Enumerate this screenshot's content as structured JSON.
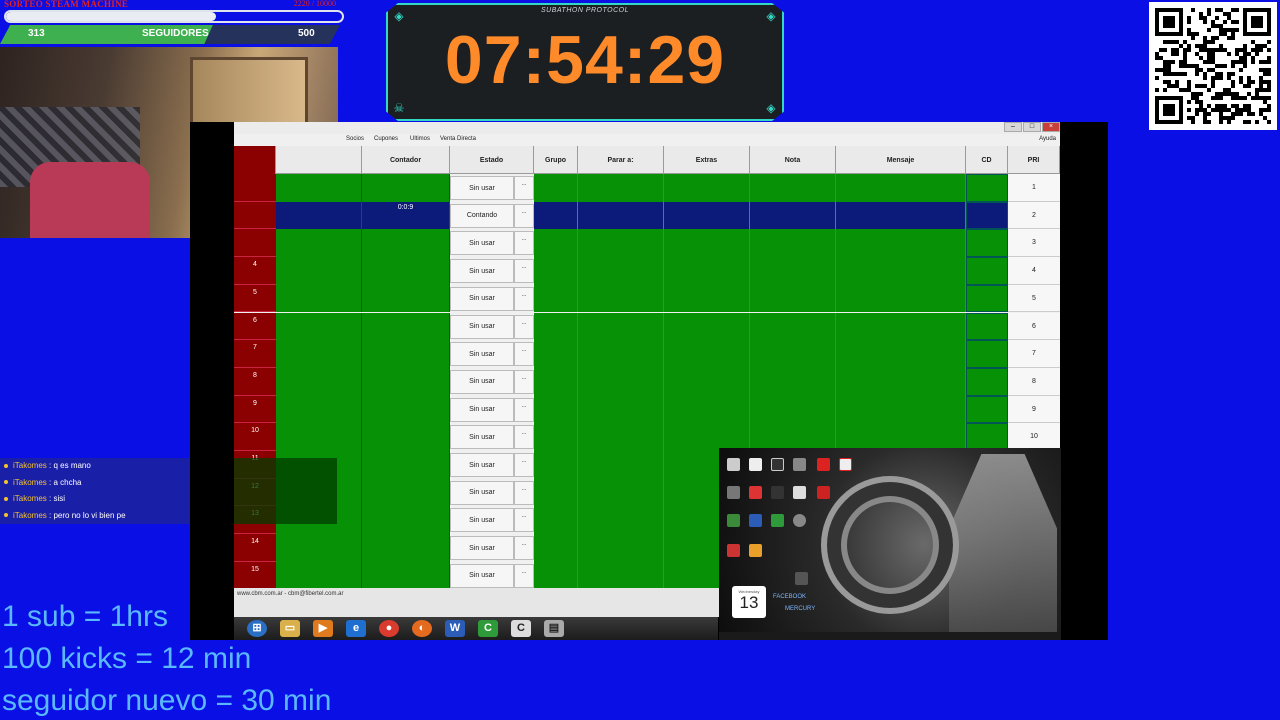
{
  "follower_bar": {
    "title": "SORTEO STEAM MACHINE",
    "range": "2220 / 10000",
    "current": "313",
    "label": "SEGUIDORES",
    "goal": "500",
    "progress": 0.626
  },
  "timer": {
    "label": "SUBATHON PROTOCOL",
    "value": "07:54:29",
    "color": "#ff8a2a"
  },
  "app": {
    "menu": [
      "Socios",
      "Cupones",
      "Ultimos",
      "Venta Directa"
    ],
    "help_menu": "Ayuda",
    "columns": [
      "Contador",
      "Estado",
      "Grupo",
      "Parar a:",
      "Extras",
      "Nota",
      "Mensaje",
      "CD",
      "PRI"
    ],
    "rows": [
      {
        "num": "",
        "estado": "Sin usar",
        "contador": "",
        "pri": "1",
        "active": false
      },
      {
        "num": "",
        "estado": "Contando",
        "contador": "0:0:9",
        "pri": "2",
        "active": true
      },
      {
        "num": "",
        "estado": "Sin usar",
        "contador": "",
        "pri": "3",
        "active": false
      },
      {
        "num": "4",
        "estado": "Sin usar",
        "contador": "",
        "pri": "4",
        "active": false
      },
      {
        "num": "5",
        "estado": "Sin usar",
        "contador": "",
        "pri": "5",
        "active": false
      },
      {
        "num": "6",
        "estado": "Sin usar",
        "contador": "",
        "pri": "6",
        "active": false
      },
      {
        "num": "7",
        "estado": "Sin usar",
        "contador": "",
        "pri": "7",
        "active": false
      },
      {
        "num": "8",
        "estado": "Sin usar",
        "contador": "",
        "pri": "8",
        "active": false
      },
      {
        "num": "9",
        "estado": "Sin usar",
        "contador": "",
        "pri": "9",
        "active": false
      },
      {
        "num": "10",
        "estado": "Sin usar",
        "contador": "",
        "pri": "10",
        "active": false
      },
      {
        "num": "11",
        "estado": "Sin usar",
        "contador": "",
        "pri": "",
        "active": false
      },
      {
        "num": "12",
        "estado": "Sin usar",
        "contador": "",
        "pri": "",
        "active": false
      },
      {
        "num": "13",
        "estado": "Sin usar",
        "contador": "",
        "pri": "",
        "active": false
      },
      {
        "num": "14",
        "estado": "Sin usar",
        "contador": "",
        "pri": "",
        "active": false
      },
      {
        "num": "15",
        "estado": "Sin usar",
        "contador": "",
        "pri": "",
        "active": false
      }
    ],
    "small_button": "...",
    "footer": "www.cbm.com.ar - cbm@fibertel.com.ar"
  },
  "taskbar": {
    "icons": [
      "start-orb-icon",
      "folder-icon",
      "media-player-icon",
      "internet-explorer-icon",
      "chrome-icon",
      "firefox-icon",
      "word-icon",
      "app-c-green-icon",
      "app-c-white-icon",
      "app-grid-icon"
    ]
  },
  "desktop": {
    "calendar_day": "Wednesday",
    "calendar_date": "13",
    "links": [
      "FACEBOOK",
      "MERCURY"
    ]
  },
  "chat": [
    {
      "user": "iTakomes",
      "message": ": q es mano"
    },
    {
      "user": "iTakomes",
      "message": ": a chcha"
    },
    {
      "user": "iTakomes",
      "message": ": sisi"
    },
    {
      "user": "iTakomes",
      "message": ": pero no lo vi bien pe"
    }
  ],
  "goals": [
    "1 sub = 1hrs",
    "100 kicks = 12 min",
    "seguidor nuevo = 30 min"
  ]
}
